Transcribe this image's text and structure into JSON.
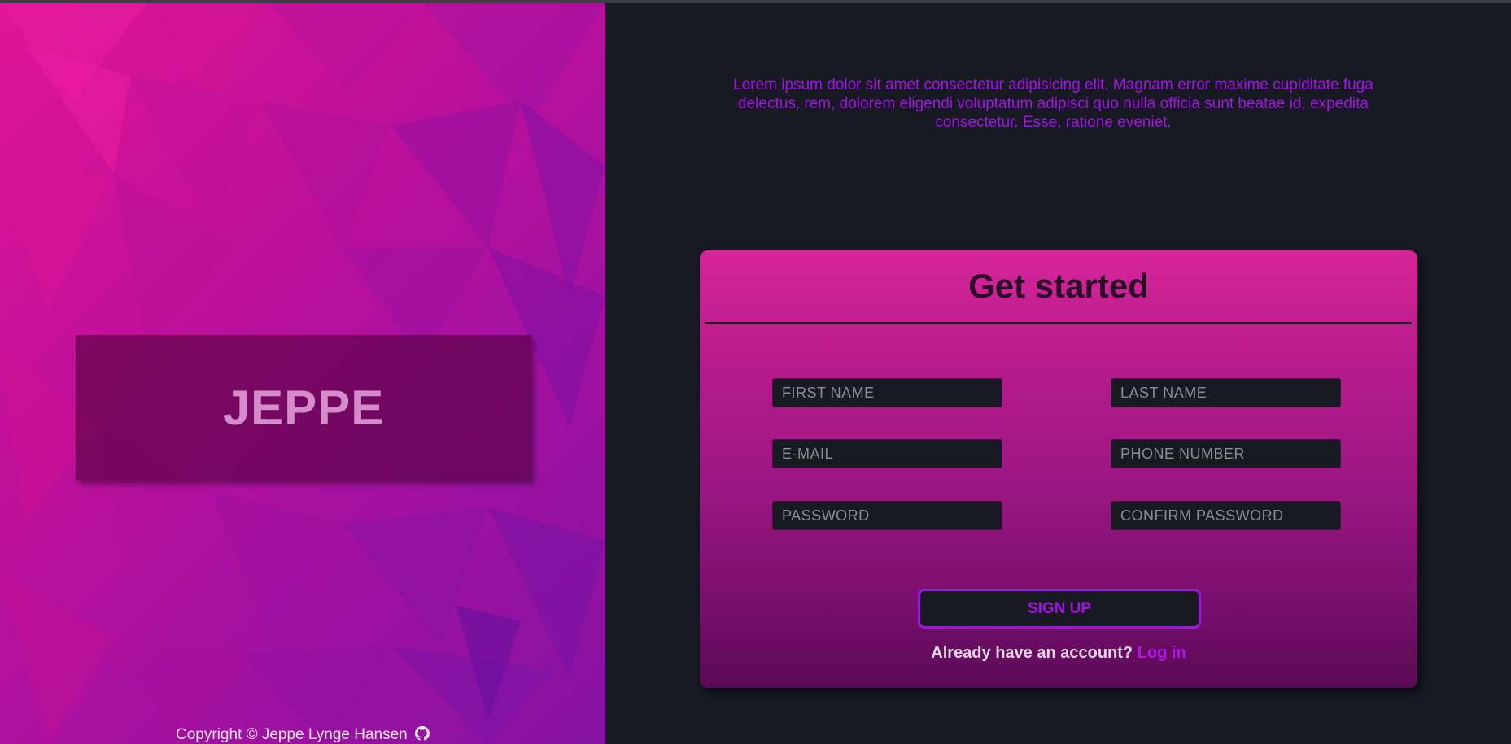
{
  "brand": {
    "title": "JEPPE"
  },
  "footer": {
    "copyright": "Copyright © Jeppe Lynge Hansen",
    "icon": "github-icon"
  },
  "intro": {
    "text": "Lorem ipsum dolor sit amet consectetur adipisicing elit. Magnam error maxime cupiditate fuga delectus, rem, dolorem eligendi voluptatum adipisci quo nulla officia sunt beatae id, expedita consectetur. Esse, ratione eveniet."
  },
  "form": {
    "title": "Get started",
    "fields": {
      "first_name": {
        "placeholder": "FIRST NAME",
        "value": ""
      },
      "last_name": {
        "placeholder": "LAST NAME",
        "value": ""
      },
      "email": {
        "placeholder": "E-MAIL",
        "value": ""
      },
      "phone": {
        "placeholder": "PHONE NUMBER",
        "value": ""
      },
      "password": {
        "placeholder": "PASSWORD",
        "value": ""
      },
      "confirm_password": {
        "placeholder": "CONFIRM PASSWORD",
        "value": ""
      }
    },
    "submit_label": "SIGN UP",
    "account_prompt": "Already have an account?",
    "login_label": "Log in"
  },
  "colors": {
    "accent": "#a413e6",
    "background": "#171923",
    "card_top": "#d6269a",
    "card_bottom": "#5a0a56"
  }
}
